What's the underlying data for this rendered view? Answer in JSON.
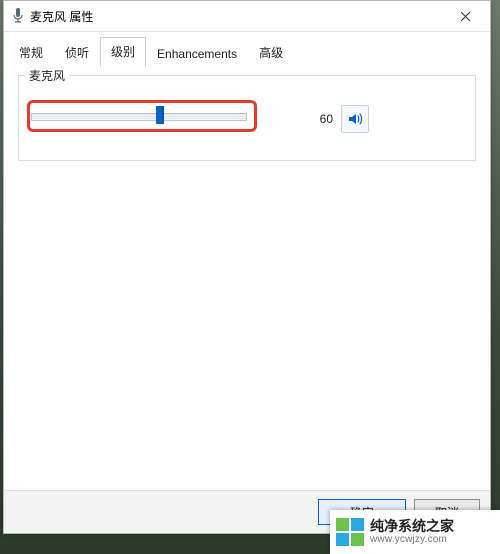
{
  "dialog": {
    "title": "麦克风 属性",
    "close_icon": "close-icon"
  },
  "tabs": [
    {
      "label": "常规",
      "active": false
    },
    {
      "label": "侦听",
      "active": false
    },
    {
      "label": "级别",
      "active": true
    },
    {
      "label": "Enhancements",
      "active": false
    },
    {
      "label": "高级",
      "active": false
    }
  ],
  "levels": {
    "group_label": "麦克风",
    "value": 60,
    "min": 0,
    "max": 100,
    "speaker_icon": "speaker-on-icon"
  },
  "buttons": {
    "ok": "确定",
    "cancel": "取消"
  },
  "watermark": {
    "line1": "纯净系统之家",
    "line2": "www.ycwjzy.com"
  },
  "colors": {
    "accent": "#0a64c8",
    "highlight": "#e33b2e"
  }
}
